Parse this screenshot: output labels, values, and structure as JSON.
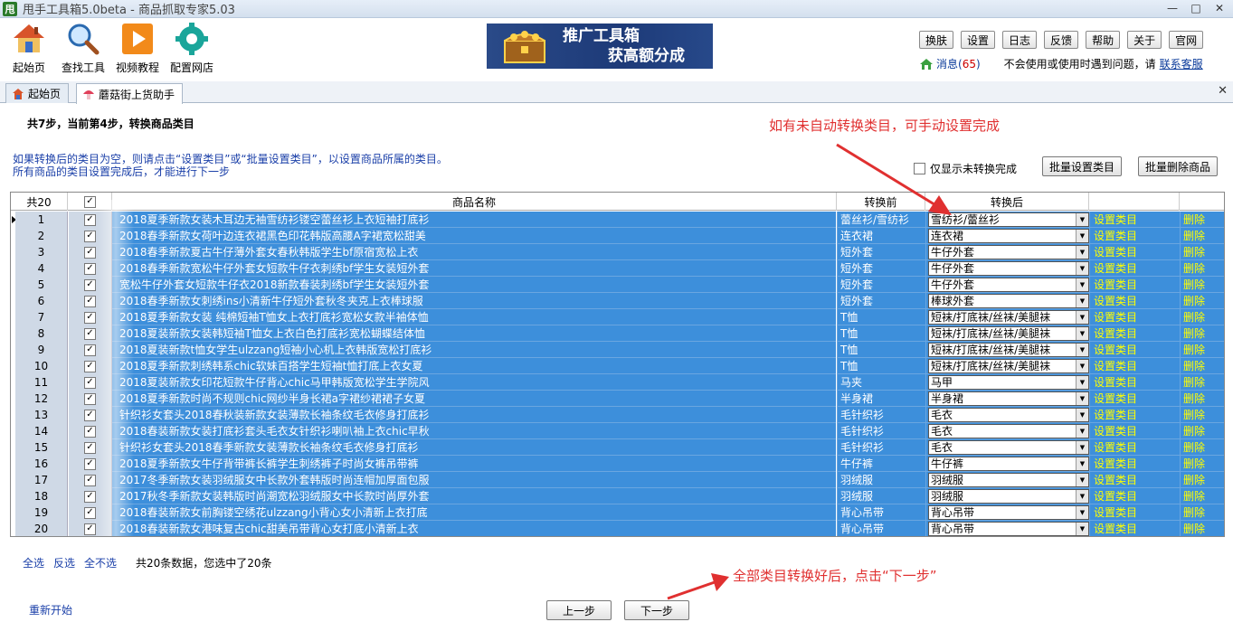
{
  "window": {
    "title": "甩手工具箱5.0beta - 商品抓取专家5.03",
    "app_icon": "甩"
  },
  "toolbar": {
    "items": [
      {
        "label": "起始页",
        "icon": "home-icon"
      },
      {
        "label": "查找工具",
        "icon": "magnifier-icon"
      },
      {
        "label": "视频教程",
        "icon": "play-icon"
      },
      {
        "label": "配置网店",
        "icon": "gear-icon"
      }
    ],
    "ad": {
      "line1": "推广工具箱",
      "line2": "获高额分成"
    },
    "buttons": [
      "换肤",
      "设置",
      "日志",
      "反馈",
      "帮助",
      "关于",
      "官网"
    ],
    "messages_label": "消息(",
    "messages_count": "65",
    "messages_close": ")",
    "note": "不会使用或使用时遇到问题，请",
    "contact": "联系客服"
  },
  "tabs": [
    {
      "label": "起始页",
      "icon": "home-icon"
    },
    {
      "label": "蘑菇街上货助手",
      "icon": "mushroom-icon"
    }
  ],
  "step_title": "共7步，当前第4步，转换商品类目",
  "hint_top": "如有未自动转换类目，可手动设置完成",
  "info_line1": "如果转换后的类目为空，则请点击“设置类目”或“批量设置类目”，以设置商品所属的类目。",
  "info_line2": "所有商品的类目设置完成后，才能进行下一步",
  "show_unconverted_label": "仅显示未转换完成",
  "batch_set_label": "批量设置类目",
  "batch_delete_label": "批量删除商品",
  "grid": {
    "header": {
      "count": "共20",
      "name": "商品名称",
      "before": "转换前",
      "after": "转换后"
    },
    "set_label": "设置类目",
    "delete_label": "删除",
    "rows": [
      {
        "idx": "1",
        "name": "2018夏季新款女装木耳边无袖雪纺衫镂空蕾丝衫上衣短袖打底衫",
        "before": "蕾丝衫/雪纺衫",
        "after": "雪纺衫/蕾丝衫"
      },
      {
        "idx": "2",
        "name": "2018春季新款女荷叶边连衣裙黑色印花韩版高腰A字裙宽松甜美",
        "before": "连衣裙",
        "after": "连衣裙"
      },
      {
        "idx": "3",
        "name": "2018春季新款夏古牛仔薄外套女春秋韩版学生bf原宿宽松上衣",
        "before": "短外套",
        "after": "牛仔外套"
      },
      {
        "idx": "4",
        "name": "2018春季新款宽松牛仔外套女短款牛仔衣刺绣bf学生女装短外套",
        "before": "短外套",
        "after": "牛仔外套"
      },
      {
        "idx": "5",
        "name": "宽松牛仔外套女短款牛仔衣2018新款春装刺绣bf学生女装短外套",
        "before": "短外套",
        "after": "牛仔外套"
      },
      {
        "idx": "6",
        "name": "2018春季新款女刺绣ins小清新牛仔短外套秋冬夹克上衣棒球服",
        "before": "短外套",
        "after": "棒球外套"
      },
      {
        "idx": "7",
        "name": "2018夏季新款女装 纯棉短袖T恤女上衣打底衫宽松女款半袖体恤",
        "before": "T恤",
        "after": "短袜/打底袜/丝袜/美腿袜"
      },
      {
        "idx": "8",
        "name": "2018夏装新款女装韩短袖T恤女上衣白色打底衫宽松蝴蝶结体恤",
        "before": "T恤",
        "after": "短袜/打底袜/丝袜/美腿袜"
      },
      {
        "idx": "9",
        "name": "2018夏装新款t恤女学生ulzzang短袖小心机上衣韩版宽松打底衫",
        "before": "T恤",
        "after": "短袜/打底袜/丝袜/美腿袜"
      },
      {
        "idx": "10",
        "name": "2018夏季新款刺绣韩系chic软妹百搭学生短袖t恤打底上衣女夏",
        "before": "T恤",
        "after": "短袜/打底袜/丝袜/美腿袜"
      },
      {
        "idx": "11",
        "name": "2018夏装新款女印花短款牛仔背心chic马甲韩版宽松学生学院风",
        "before": "马夹",
        "after": "马甲"
      },
      {
        "idx": "12",
        "name": "2018夏季新款时尚不规则chic网纱半身长裙a字裙纱裙裙子女夏",
        "before": "半身裙",
        "after": "半身裙"
      },
      {
        "idx": "13",
        "name": "针织衫女套头2018春秋装新款女装薄款长袖条纹毛衣修身打底衫",
        "before": "毛针织衫",
        "after": "毛衣"
      },
      {
        "idx": "14",
        "name": "2018春装新款女装打底衫套头毛衣女针织衫喇叭袖上衣chic早秋",
        "before": "毛针织衫",
        "after": "毛衣"
      },
      {
        "idx": "15",
        "name": "针织衫女套头2018春季新款女装薄款长袖条纹毛衣修身打底衫",
        "before": "毛针织衫",
        "after": "毛衣"
      },
      {
        "idx": "16",
        "name": "2018夏季新款女牛仔背带裤长裤学生刺绣裤子时尚女裤吊带裤",
        "before": "牛仔裤",
        "after": "牛仔裤"
      },
      {
        "idx": "17",
        "name": "2017冬季新款女装羽绒服女中长款外套韩版时尚连帽加厚面包服",
        "before": "羽绒服",
        "after": "羽绒服"
      },
      {
        "idx": "18",
        "name": "2017秋冬季新款女装韩版时尚潮宽松羽绒服女中长款时尚厚外套",
        "before": "羽绒服",
        "after": "羽绒服"
      },
      {
        "idx": "19",
        "name": "2018春装新款女前胸镂空绣花ulzzang小背心女小清新上衣打底",
        "before": "背心吊带",
        "after": "背心吊带"
      },
      {
        "idx": "20",
        "name": "2018春装新款女港味复古chic甜美吊带背心女打底小清新上衣",
        "before": "背心吊带",
        "after": "背心吊带"
      }
    ]
  },
  "bottom": {
    "select_all": "全选",
    "invert": "反选",
    "select_none": "全不选",
    "summary": "共20条数据，您选中了20条",
    "hint_bottom": "全部类目转换好后，点击“下一步”",
    "restart": "重新开始",
    "prev": "上一步",
    "next": "下一步"
  },
  "colors": {
    "row_highlight": "#3d8fdb",
    "hint_red": "#e03030",
    "link_blue": "#1a3fa8",
    "action_yellow": "#ffff00"
  }
}
